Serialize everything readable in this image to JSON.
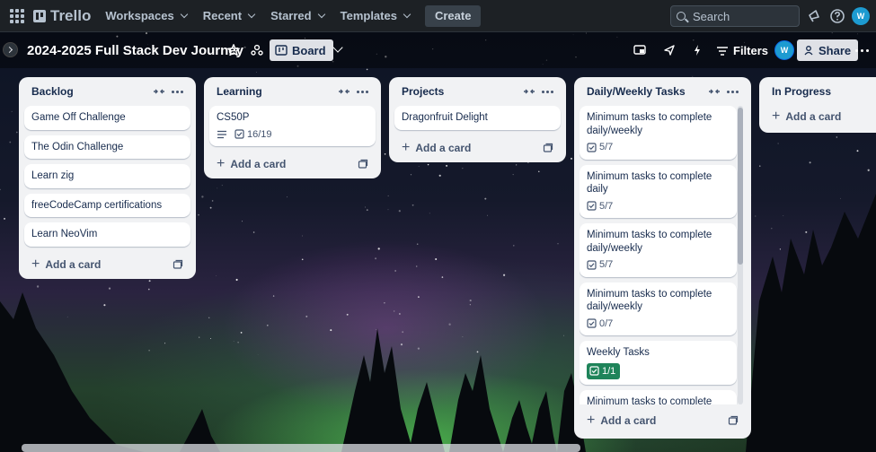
{
  "topnav": {
    "app_name": "Trello",
    "menu": [
      "Workspaces",
      "Recent",
      "Starred",
      "Templates"
    ],
    "create_label": "Create",
    "search_placeholder": "Search",
    "avatar_initials": "W"
  },
  "board": {
    "title": "2024-2025 Full Stack Dev Journey",
    "view_label": "Board",
    "filters_label": "Filters",
    "share_label": "Share",
    "avatar_initials": "W"
  },
  "lists": [
    {
      "title": "Backlog",
      "cards": [
        {
          "title": "Game Off Challenge"
        },
        {
          "title": "The Odin Challenge"
        },
        {
          "title": "Learn zig"
        },
        {
          "title": "freeCodeCamp certifications"
        },
        {
          "title": "Learn NeoVim"
        }
      ],
      "add_label": "Add a card"
    },
    {
      "title": "Learning",
      "cards": [
        {
          "title": "CS50P",
          "has_description": true,
          "checklist": "16/19"
        }
      ],
      "add_label": "Add a card"
    },
    {
      "title": "Projects",
      "cards": [
        {
          "title": "Dragonfruit Delight"
        }
      ],
      "add_label": "Add a card"
    },
    {
      "title": "Daily/Weekly Tasks",
      "cards": [
        {
          "title": "Minimum tasks to complete daily/weekly",
          "checklist": "5/7"
        },
        {
          "title": "Minimum tasks to complete daily",
          "checklist": "5/7"
        },
        {
          "title": "Minimum tasks to complete daily/weekly",
          "checklist": "5/7"
        },
        {
          "title": "Minimum tasks to complete daily/weekly",
          "checklist": "0/7"
        },
        {
          "title": "Weekly Tasks",
          "checklist": "1/1",
          "complete": true
        },
        {
          "title": "Minimum tasks to complete daily/weekly"
        }
      ],
      "add_label": "Add a card"
    },
    {
      "title": "In Progress",
      "cards": [],
      "add_label": "Add a card"
    }
  ],
  "colors": {
    "nav_bg": "#1d2125",
    "list_bg": "#f1f2f4",
    "checklist_complete": "#1f845a",
    "avatar": "#1d9bd1"
  }
}
